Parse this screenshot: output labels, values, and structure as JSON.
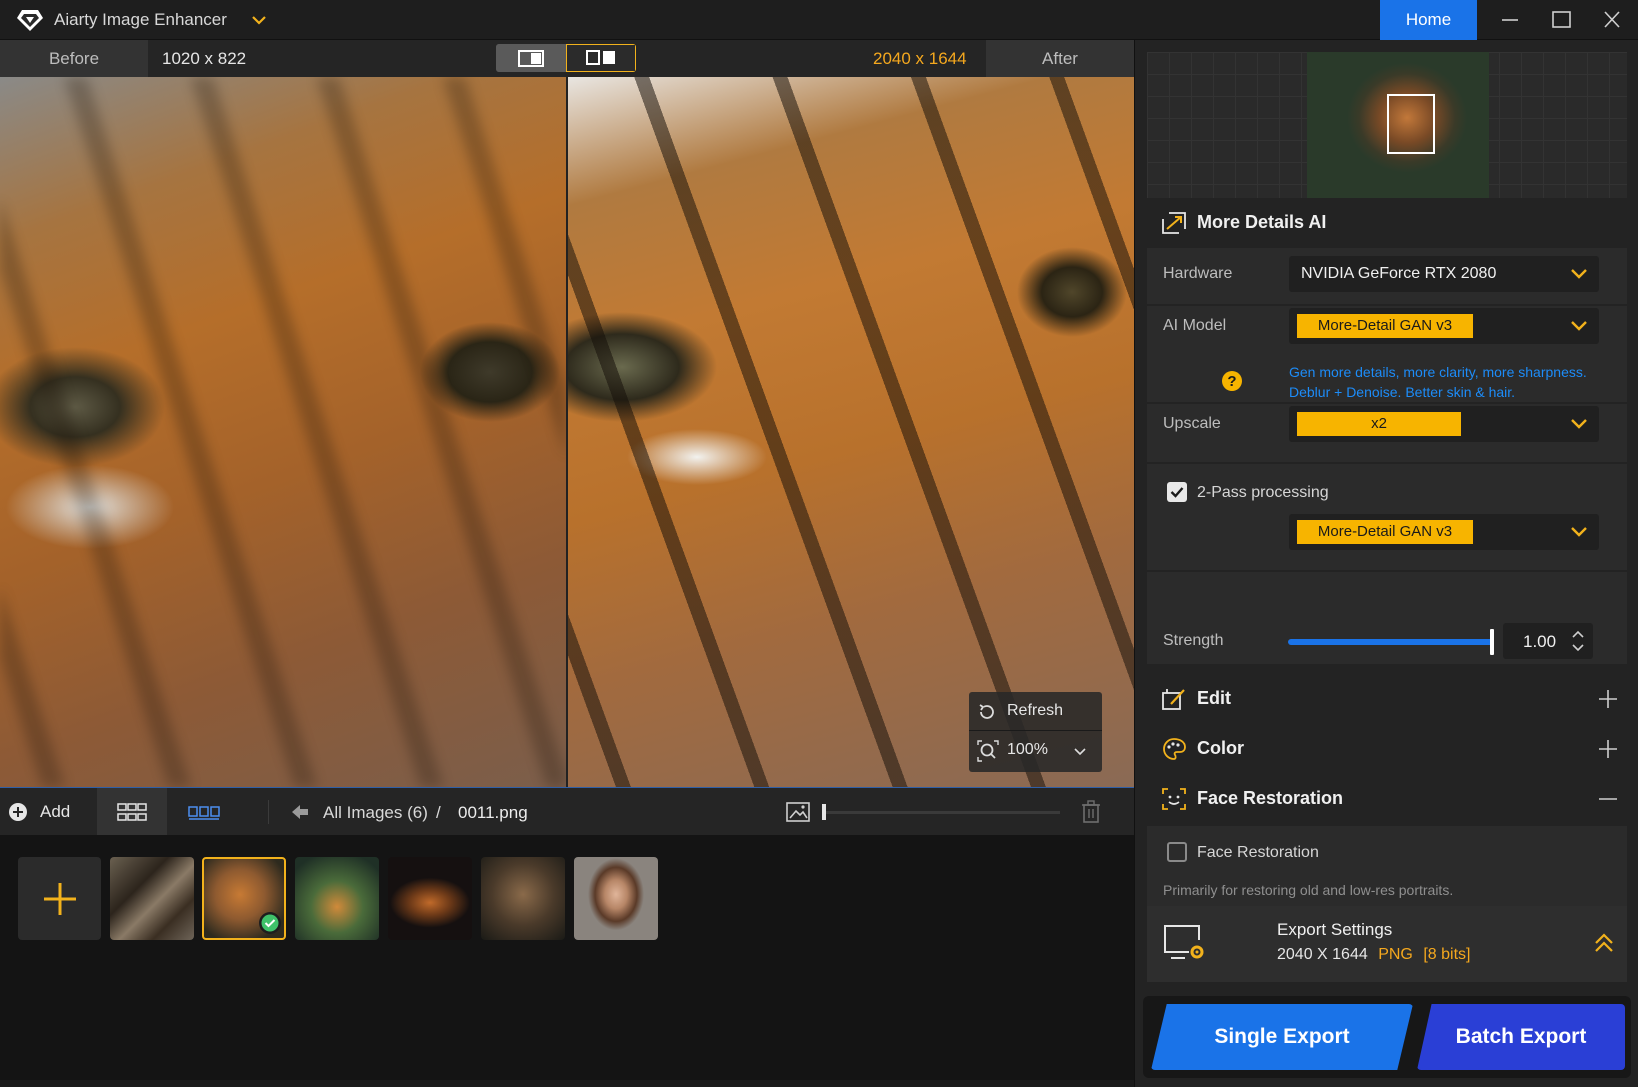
{
  "window": {
    "title": "Aiarty Image Enhancer",
    "home_label": "Home"
  },
  "compare": {
    "before_label": "Before",
    "before_size": "1020 x 822",
    "after_size": "2040 x 1644",
    "after_label": "After"
  },
  "floating": {
    "refresh_label": "Refresh",
    "zoom_label": "100%"
  },
  "bottom_toolbar": {
    "add_label": "Add",
    "breadcrumb_all": "All Images (6)",
    "breadcrumb_sep": "/",
    "breadcrumb_file": "0011.png"
  },
  "thumbnails": {
    "count": 6,
    "selected_index": 1
  },
  "panel": {
    "section_title": "More Details AI",
    "hardware_label": "Hardware",
    "hardware_value": "NVIDIA GeForce RTX 2080",
    "ai_model_label": "AI Model",
    "ai_model_value": "More-Detail GAN  v3",
    "ai_model_desc_1": "Gen more details, more clarity, more sharpness.",
    "ai_model_desc_2": "Deblur + Denoise. Better skin & hair.",
    "upscale_label": "Upscale",
    "upscale_value": "x2",
    "two_pass_label": "2-Pass processing",
    "two_pass_checked": true,
    "two_pass_model": "More-Detail GAN  v3",
    "strength_label": "Strength",
    "strength_value": "1.00",
    "edit_title": "Edit",
    "color_title": "Color",
    "face_title": "Face Restoration",
    "face_checkbox_label": "Face Restoration",
    "face_checked": false,
    "face_desc": "Primarily for restoring old and low-res portraits."
  },
  "export": {
    "title": "Export Settings",
    "dims": "2040 X 1644",
    "format": "PNG",
    "bits": "[8 bits]",
    "single_label": "Single Export",
    "batch_label": "Batch Export"
  },
  "colors": {
    "accent_blue": "#1a73e8",
    "accent_orange": "#f5a81e",
    "pill_yellow": "#f7b400",
    "batch_blue": "#2a3fd6"
  }
}
